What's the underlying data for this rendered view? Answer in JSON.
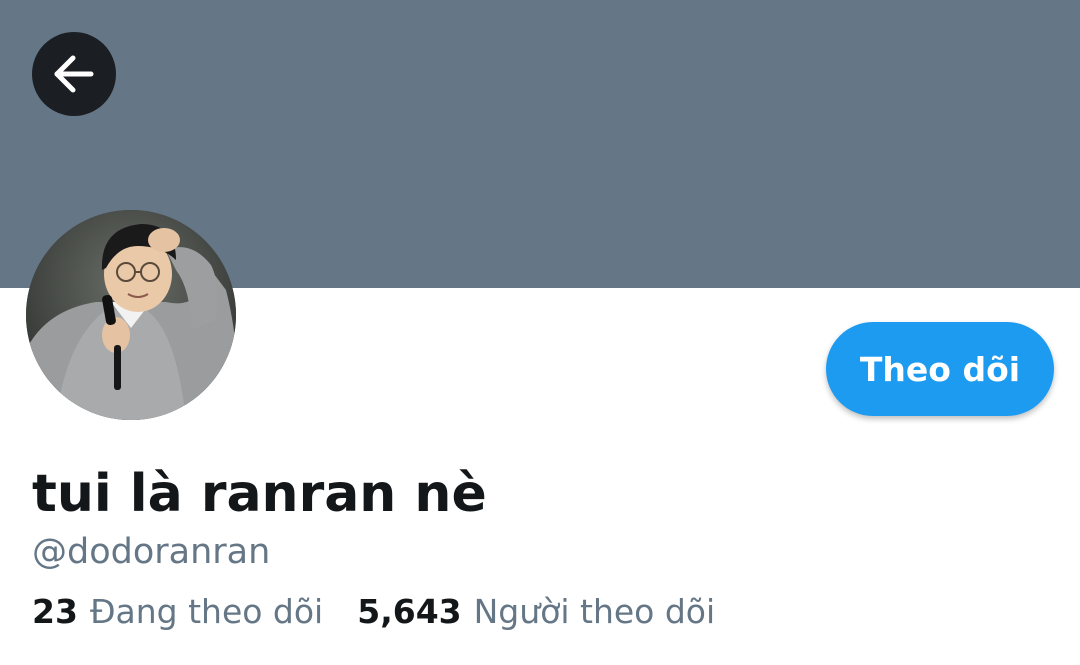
{
  "header": {
    "banner_color": "#657786",
    "back_icon": "arrow-left-icon"
  },
  "profile": {
    "display_name": "tui là ranran nè",
    "handle": "@dodoranran",
    "follow_label": "Theo dõi",
    "accent_color": "#1d9bf0"
  },
  "stats": {
    "following_count": "23",
    "following_label": "Đang theo dõi",
    "followers_count": "5,643",
    "followers_label": "Người theo dõi"
  }
}
